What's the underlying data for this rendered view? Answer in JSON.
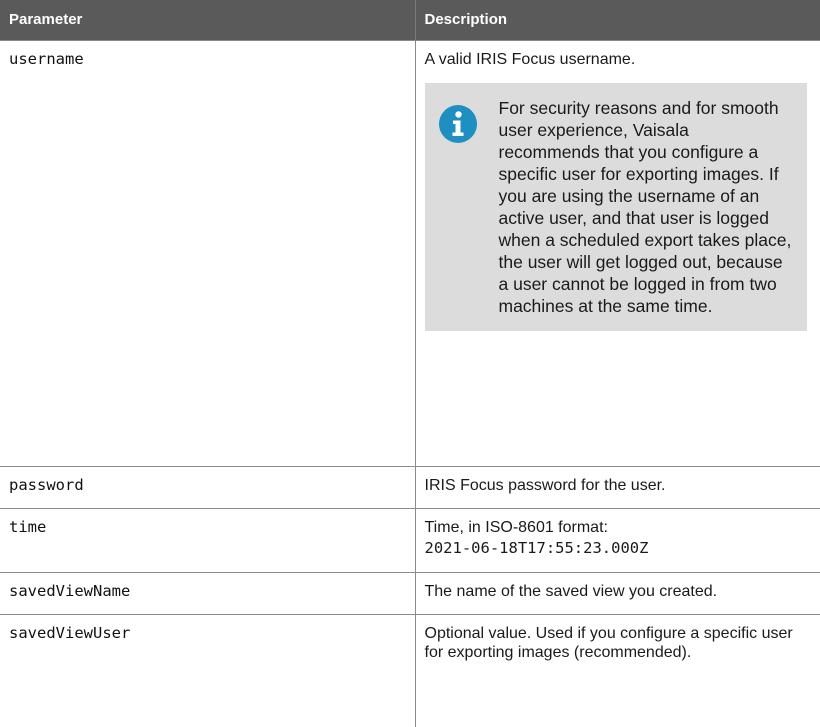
{
  "table": {
    "header": {
      "parameter": "Parameter",
      "description": "Description"
    },
    "rows": [
      {
        "name": "username",
        "description": "A valid IRIS Focus username.",
        "note": {
          "icon": "info-icon",
          "color": "#1f8fc1",
          "text": "For security reasons and for smooth user experience, Vaisala recommends that you configure a specific user for exporting images. If you are using the username of an active user, and that user is logged when a scheduled export takes place, the user will get logged out, because a user cannot be logged in from two machines at the same time."
        }
      },
      {
        "name": "password",
        "description": "IRIS Focus password for the user."
      },
      {
        "name": "time",
        "description": "Time, in ISO-8601 format:",
        "example": "2021-06-18T17:55:23.000Z"
      },
      {
        "name": "savedViewName",
        "description": "The name of the saved view you created."
      },
      {
        "name": "savedViewUser",
        "description": "Optional value. Used if you configure a specific user for exporting images (recommended)."
      }
    ]
  },
  "colors": {
    "header_bg": "#5a5a5a",
    "note_bg": "#dcdcdc",
    "info_icon": "#1f8fc1"
  }
}
